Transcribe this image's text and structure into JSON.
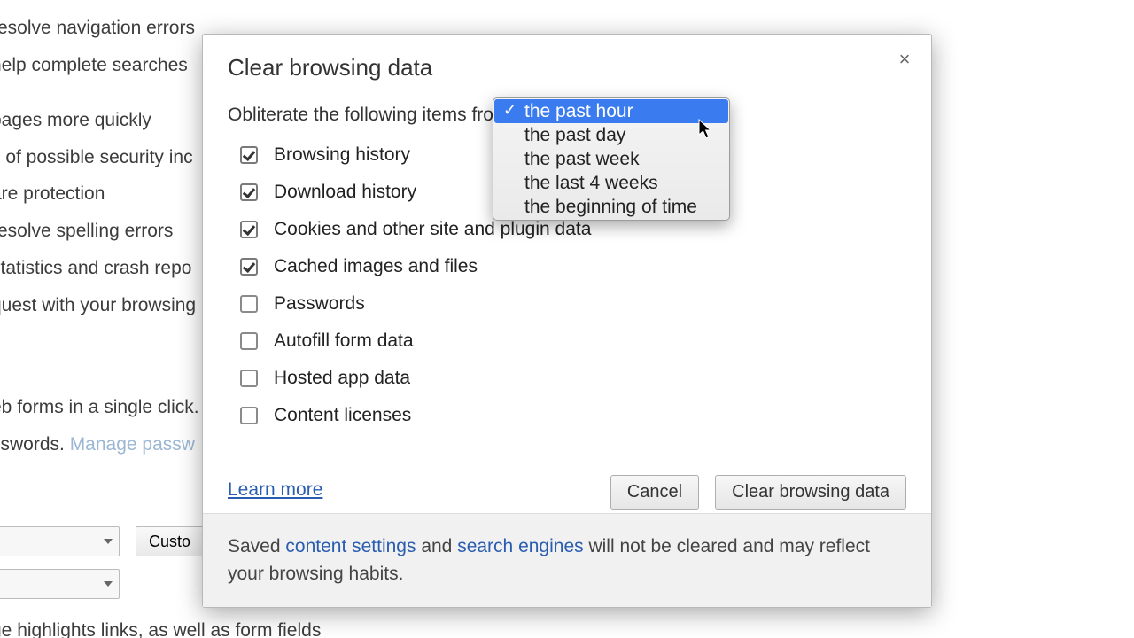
{
  "background": {
    "lines": {
      "l1": " resolve navigation errors",
      "l2": " help complete searches",
      "l3": " pages more quickly",
      "l4": "s of possible security inc",
      "l5": "are protection",
      "l6": " resolve spelling errors",
      "l7": " statistics and crash repo",
      "l8": "quest with your browsing",
      "l9": "eb forms in a single click.",
      "l10_a": "sswords. ",
      "l10_b": "Manage passw",
      "l11": "ge highlights links, as well as form fields"
    },
    "customize_btn": "Custo"
  },
  "dialog": {
    "title": "Clear browsing data",
    "close_label": "×",
    "prompt": "Obliterate the following items from",
    "items": [
      {
        "label": "Browsing history",
        "checked": true
      },
      {
        "label": "Download history",
        "checked": true
      },
      {
        "label": "Cookies and other site and plugin data",
        "checked": true
      },
      {
        "label": "Cached images and files",
        "checked": true
      },
      {
        "label": "Passwords",
        "checked": false
      },
      {
        "label": "Autofill form data",
        "checked": false
      },
      {
        "label": "Hosted app data",
        "checked": false
      },
      {
        "label": "Content licenses",
        "checked": false
      }
    ],
    "learn_more": "Learn more",
    "cancel": "Cancel",
    "confirm": "Clear browsing data",
    "footer_a": "Saved ",
    "footer_link1": "content settings",
    "footer_b": " and ",
    "footer_link2": "search engines",
    "footer_c": " will not be cleared and may reflect your browsing habits."
  },
  "dropdown": {
    "options": [
      "the past hour",
      "the past day",
      "the past week",
      "the last 4 weeks",
      "the beginning of time"
    ],
    "selected_index": 0
  }
}
